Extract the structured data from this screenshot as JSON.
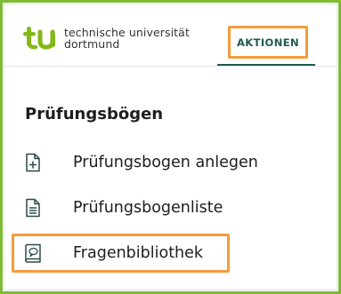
{
  "header": {
    "logo_line1": "technische universität",
    "logo_line2": "dortmund",
    "nav_tab_label": "AKTIONEN"
  },
  "section": {
    "title": "Prüfungsbögen",
    "items": [
      {
        "label": "Prüfungsbogen anlegen",
        "icon": "file-plus-icon"
      },
      {
        "label": "Prüfungsbogenliste",
        "icon": "file-lines-icon"
      },
      {
        "label": "Fragenbibliothek",
        "icon": "book-question-icon"
      }
    ]
  },
  "colors": {
    "frame_border": "#7dbb36",
    "highlight_border": "#f39c3c",
    "accent_teal": "#1f5a52",
    "logo_green": "#84b817"
  }
}
